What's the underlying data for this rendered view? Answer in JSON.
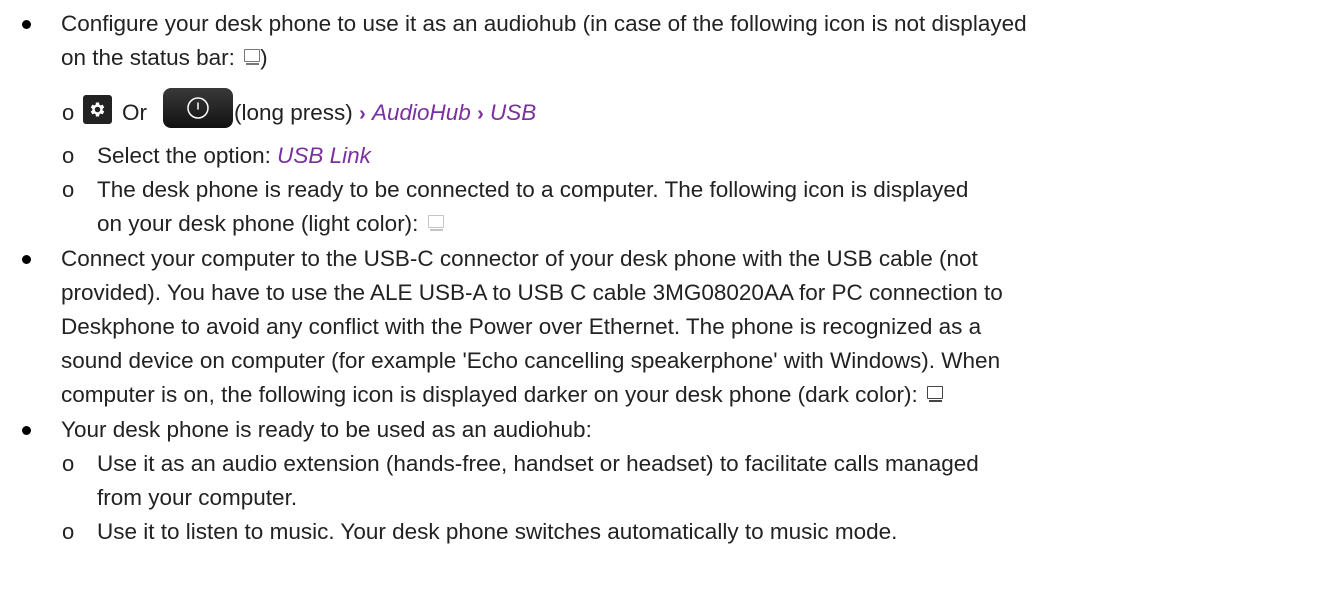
{
  "bullets": [
    {
      "line1": "Configure your desk phone to use it as an audiohub (in case of the following icon is not displayed",
      "line2_text": "on the status bar: ",
      "line2_close": ")",
      "subitems": {
        "path": {
          "or_text": "Or",
          "long_press_text": "(long press)",
          "arrow": "›",
          "audiohub_link": "AudioHub",
          "usb_link": "USB"
        },
        "select_text": "Select the option: ",
        "select_link": "USB Link",
        "ready_line1": "The desk phone is ready to be connected to a computer. The following icon is displayed",
        "ready_line2": "on your desk phone (light color): "
      }
    },
    {
      "lines": [
        "Connect your computer to the USB-C connector of your desk phone with the USB cable (not",
        "provided). You have to use the ALE USB-A to USB C cable 3MG08020AA for PC connection to",
        "Deskphone to avoid any conflict with the Power over Ethernet. The phone is recognized as a",
        "sound device on computer (for example 'Echo cancelling speakerphone' with Windows). When",
        "computer is on, the following icon is displayed darker on your desk phone (dark color): "
      ]
    },
    {
      "line1": "Your desk phone is ready to be used as an audiohub:",
      "subitems": {
        "extension_line1": "Use it as an audio extension (hands-free, handset or headset) to facilitate calls managed",
        "extension_line2": "from your computer.",
        "music_line": "Use it to listen to music. Your desk phone switches automatically to music mode."
      }
    }
  ],
  "icons": [
    "monitor-icon",
    "gear-icon",
    "power-icon"
  ],
  "colors": {
    "link": "#7a2f9e",
    "text": "#222222"
  }
}
